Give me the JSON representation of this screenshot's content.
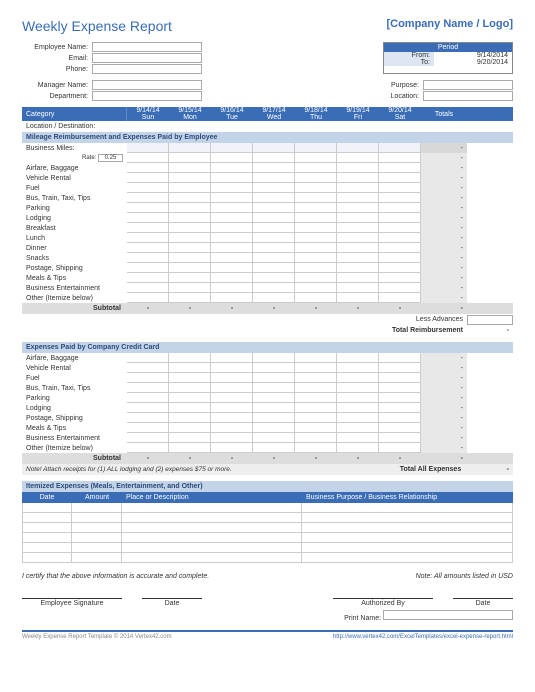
{
  "title": "Weekly Expense Report",
  "company_placeholder": "[Company Name / Logo]",
  "meta_left1": [
    {
      "label": "Employee Name:"
    },
    {
      "label": "Email:"
    },
    {
      "label": "Phone:"
    }
  ],
  "meta_left2": [
    {
      "label": "Manager Name:"
    },
    {
      "label": "Department:"
    }
  ],
  "meta_right2": [
    {
      "label": "Purpose:"
    },
    {
      "label": "Location:"
    }
  ],
  "period": {
    "header": "Period",
    "from_label": "From:",
    "from_val": "9/14/2014",
    "to_label": "To:",
    "to_val": "9/20/2014"
  },
  "cat_label": "Category",
  "days": [
    {
      "date": "9/14/14",
      "dow": "Sun"
    },
    {
      "date": "9/15/14",
      "dow": "Mon"
    },
    {
      "date": "9/16/14",
      "dow": "Tue"
    },
    {
      "date": "9/17/14",
      "dow": "Wed"
    },
    {
      "date": "9/18/14",
      "dow": "Thu"
    },
    {
      "date": "9/19/14",
      "dow": "Fri"
    },
    {
      "date": "9/20/14",
      "dow": "Sat"
    }
  ],
  "totals_label": "Totals",
  "location_dest": "Location / Destination:",
  "section1": "Mileage Reimbursement and Expenses Paid by Employee",
  "business_miles": "Business Miles:",
  "rate_label": "Rate:",
  "rate_val": "0.25",
  "rows1": [
    "Airfare, Baggage",
    "Vehicle Rental",
    "Fuel",
    "Bus, Train, Taxi, Tips",
    "Parking",
    "Lodging",
    "Breakfast",
    "Lunch",
    "Dinner",
    "Snacks",
    "Postage, Shipping",
    "Meals & Tips",
    "Business Entertainment",
    "Other (Itemize below)"
  ],
  "subtotal": "Subtotal",
  "less_adv": "Less Advances",
  "total_reimb": "Total Reimbursement",
  "section2": "Expenses Paid by Company Credit Card",
  "rows2": [
    "Airfare, Baggage",
    "Vehicle Rental",
    "Fuel",
    "Bus, Train, Taxi, Tips",
    "Parking",
    "Lodging",
    "Postage, Shipping",
    "Meals & Tips",
    "Business Entertainment",
    "Other (Itemize below)"
  ],
  "note": "Note!  Attach receipts for (1) ALL lodging and (2) expenses $75 or more.",
  "total_all": "Total All Expenses",
  "section3": "Itemized Expenses (Meals, Entertainment, and Other)",
  "item_headers": {
    "date": "Date",
    "amount": "Amount",
    "desc": "Place or Description",
    "purpose": "Business Purpose / Business Relationship"
  },
  "item_rows": 6,
  "certify": "I certify that the above information is accurate and complete.",
  "note_usd": "Note: All amounts listed in USD",
  "sig": {
    "emp": "Employee Signature",
    "date": "Date",
    "auth": "Authorized By",
    "print": "Print Name:"
  },
  "footer": {
    "left": "Weekly Expense Report Template  © 2014 Vertex42.com",
    "right": "http://www.vertex42.com/ExcelTemplates/excel-expense-report.html"
  },
  "dash": "-"
}
